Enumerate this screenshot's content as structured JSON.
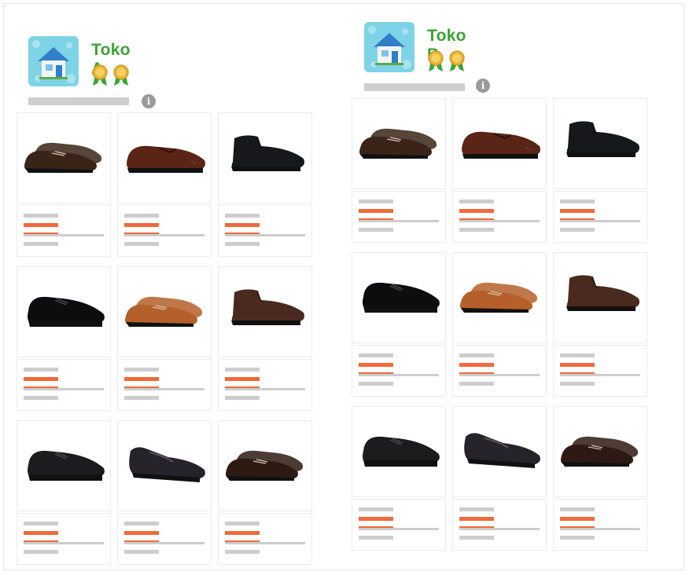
{
  "stores": [
    {
      "name": "Toko A",
      "avatar_icon": "house-icon",
      "medal_count": 2,
      "info_icon_glyph": "i",
      "products": [
        {
          "shoe_color": "#3a2418",
          "style": "pair-oxford"
        },
        {
          "shoe_color": "#5a2516",
          "style": "brogue"
        },
        {
          "shoe_color": "#16181c",
          "style": "chukka"
        },
        {
          "shoe_color": "#0d0d0f",
          "style": "derby"
        },
        {
          "shoe_color": "#b5602a",
          "style": "pair-oxford-tan"
        },
        {
          "shoe_color": "#4a2a1e",
          "style": "boot"
        },
        {
          "shoe_color": "#1c1c1e",
          "style": "derby-lace"
        },
        {
          "shoe_color": "#26232a",
          "style": "loafer"
        },
        {
          "shoe_color": "#2e1a12",
          "style": "pair-oxford"
        }
      ]
    },
    {
      "name": "Toko B",
      "avatar_icon": "house-icon",
      "medal_count": 2,
      "info_icon_glyph": "i",
      "products": [
        {
          "shoe_color": "#3a2418",
          "style": "pair-oxford"
        },
        {
          "shoe_color": "#5a2516",
          "style": "brogue"
        },
        {
          "shoe_color": "#16181c",
          "style": "chukka"
        },
        {
          "shoe_color": "#0d0d0f",
          "style": "derby"
        },
        {
          "shoe_color": "#b5602a",
          "style": "pair-oxford-tan"
        },
        {
          "shoe_color": "#4a2a1e",
          "style": "boot"
        },
        {
          "shoe_color": "#1c1c1e",
          "style": "derby-lace"
        },
        {
          "shoe_color": "#26232a",
          "style": "loafer"
        },
        {
          "shoe_color": "#2e1a12",
          "style": "pair-oxford"
        }
      ]
    }
  ],
  "colors": {
    "store_name": "#3aa335",
    "accent_bar": "#f16a3a",
    "placeholder_bar": "#cdcdcd",
    "avatar_bg": "#7fd3e6",
    "medal_gold": "#e8b634",
    "medal_ribbon": "#3aa335"
  }
}
